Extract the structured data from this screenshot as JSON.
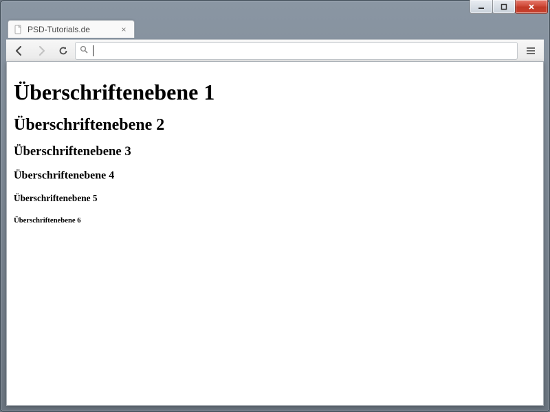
{
  "window": {
    "controls": {
      "minimize": "–",
      "maximize": "□",
      "close": "✕"
    }
  },
  "tab": {
    "title": "PSD-Tutorials.de",
    "close_label": "×"
  },
  "toolbar": {
    "omnibox_value": ""
  },
  "page": {
    "h1": "Überschriftenebene 1",
    "h2": "Überschriftenebene 2",
    "h3": "Überschriftenebene 3",
    "h4": "Überschriftenebene 4",
    "h5": "Überschriftenebene 5",
    "h6": "Überschriftenebene 6"
  }
}
